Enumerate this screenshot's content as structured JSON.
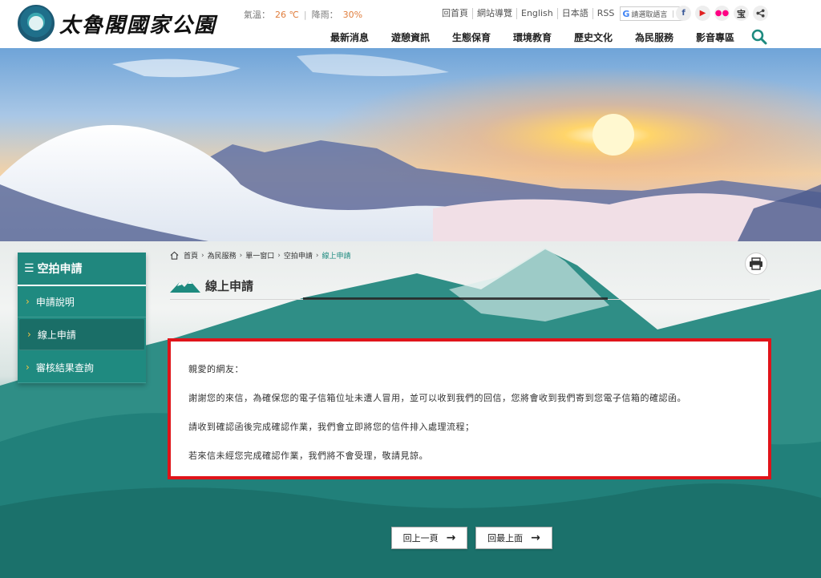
{
  "header": {
    "site_title": "太魯閣國家公園",
    "weather": {
      "temp_label": "氣溫：",
      "temp_value": "26 ℃",
      "rain_label": "降雨：",
      "rain_value": "30%"
    },
    "toplinks": [
      "回首頁",
      "網站導覽",
      "English",
      "日本語",
      "RSS"
    ],
    "translate_label": "請選取語言",
    "socials": [
      "f",
      "▶",
      "flickr",
      "宝",
      "share"
    ],
    "nav": [
      "最新消息",
      "遊憩資訊",
      "生態保育",
      "環境教育",
      "歷史文化",
      "為民服務",
      "影音專區"
    ]
  },
  "sidebar": {
    "title": "空拍申請",
    "items": [
      {
        "label": "申請說明",
        "active": false
      },
      {
        "label": "線上申請",
        "active": true
      },
      {
        "label": "審核結果查詢",
        "active": false
      }
    ]
  },
  "breadcrumb": [
    "首頁",
    "為民服務",
    "單一窗口",
    "空拍申請",
    "線上申請"
  ],
  "page_title": "線上申請",
  "message": {
    "greeting": "親愛的網友：",
    "line1": "謝謝您的來信，為確保您的電子信箱位址未遭人冒用，並可以收到我們的回信，您將會收到我們寄到您電子信箱的確認函。",
    "line2": "請收到確認函後完成確認作業，我們會立即將您的信件排入處理流程；",
    "line3": "若來信未經您完成確認作業，我們將不會受理，敬請見諒。"
  },
  "buttons": {
    "prev": "回上一頁",
    "top": "回最上面"
  },
  "colors": {
    "accent": "#1f8a80",
    "highlight": "#e0141a",
    "temp": "#e07d3c"
  }
}
